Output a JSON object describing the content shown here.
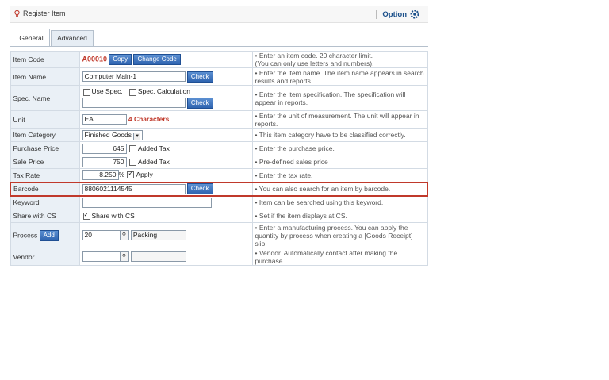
{
  "header": {
    "title": "Register Item",
    "option_label": "Option"
  },
  "tabs": [
    {
      "label": "General"
    },
    {
      "label": "Advanced"
    }
  ],
  "rows": {
    "item_code": {
      "label": "Item Code",
      "code": "A00010",
      "copy_btn": "Copy",
      "change_btn": "Change Code",
      "desc": "• Enter an item code. 20 character limit.\n  (You can only use letters and numbers)."
    },
    "item_name": {
      "label": "Item Name",
      "value": "Computer Main-1",
      "check_btn": "Check",
      "desc": "• Enter the item name. The item name appears in search results and reports."
    },
    "spec_name": {
      "label": "Spec. Name",
      "use_spec": "Use Spec.",
      "spec_calc": "Spec. Calculation",
      "check_btn": "Check",
      "desc": "• Enter the item specification. The specification will appear in reports."
    },
    "unit": {
      "label": "Unit",
      "value": "EA",
      "hint": "4 Characters",
      "desc": "• Enter the unit of measurement. The unit will appear in reports."
    },
    "item_category": {
      "label": "Item Category",
      "value": "Finished Goods",
      "desc": "• This item category have to be classified correctly."
    },
    "purchase_price": {
      "label": "Purchase Price",
      "value": "645",
      "added_tax": "Added Tax",
      "desc": "• Enter the purchase price."
    },
    "sale_price": {
      "label": "Sale Price",
      "value": "750",
      "added_tax": "Added Tax",
      "desc": "• Pre-defined sales price"
    },
    "tax_rate": {
      "label": "Tax Rate",
      "value": "8.250",
      "pct": "%",
      "apply": "Apply",
      "desc": "• Enter the tax rate."
    },
    "barcode": {
      "label": "Barcode",
      "value": "8806021114545",
      "check_btn": "Check",
      "desc": "• You can also search for an item by barcode."
    },
    "keyword": {
      "label": "Keyword",
      "value": "",
      "desc": "• Item can be searched using this keyword."
    },
    "share_cs": {
      "label": "Share with CS",
      "check_label": "Share with CS",
      "desc": "• Set if the item displays at CS."
    },
    "process": {
      "label": "Process",
      "add_btn": "Add",
      "code": "20",
      "name": "Packing",
      "desc": "• Enter a manufacturing process. You can apply the quantity by process when creating a [Goods Receipt] slip."
    },
    "vendor": {
      "label": "Vendor",
      "code": "",
      "name": "",
      "desc": "• Vendor. Automatically contact after making the purchase."
    }
  },
  "colors": {
    "highlight": "#c0392b",
    "accent": "#2f64b0",
    "label_bg": "#eaf0f6"
  }
}
